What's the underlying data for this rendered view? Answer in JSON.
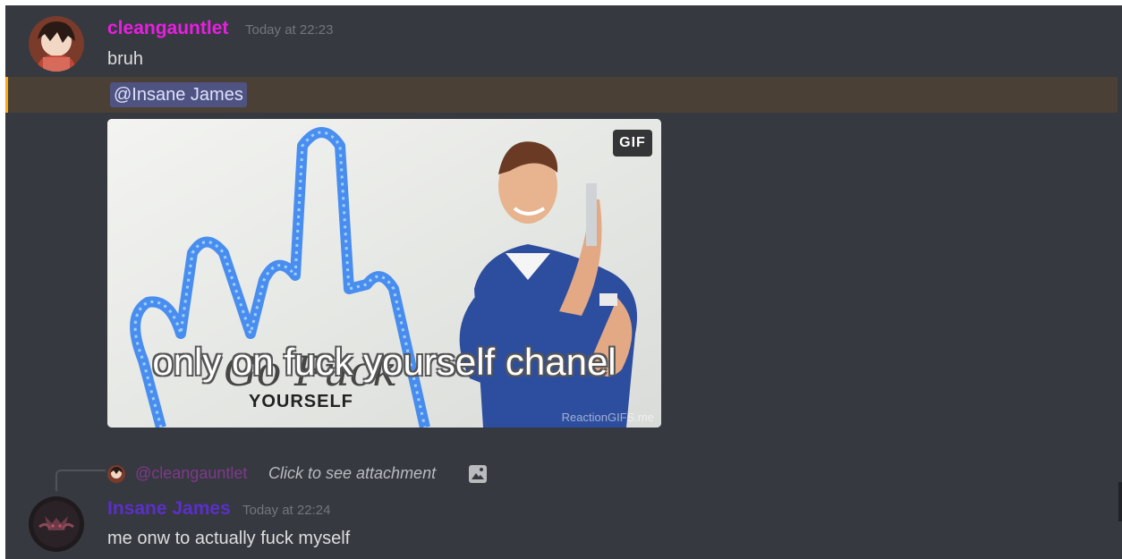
{
  "messages": [
    {
      "author": "cleangauntlet",
      "author_color": "#e91ee3",
      "timestamp": "Today at 22:23",
      "lines": [
        "bruh"
      ],
      "mention": "@Insane James",
      "attachment": {
        "badge": "GIF",
        "caption": "only on fuck yourself chanel",
        "art_script_text": "Go Fuck",
        "art_word": "YOURSELF",
        "watermark": "ReactionGIFS.me"
      }
    },
    {
      "reply": {
        "author": "@cleangauntlet",
        "text": "Click to see attachment",
        "icon": "image-icon"
      },
      "author": "Insane James",
      "author_color": "#5b2fc9",
      "timestamp": "Today at 22:24",
      "lines": [
        "me onw to actually fuck myself"
      ]
    }
  ],
  "colors": {
    "background": "#36393f",
    "mention_highlight": "#4a4035",
    "mention_border": "#faa61a",
    "mention_pill": "#4f5382"
  }
}
